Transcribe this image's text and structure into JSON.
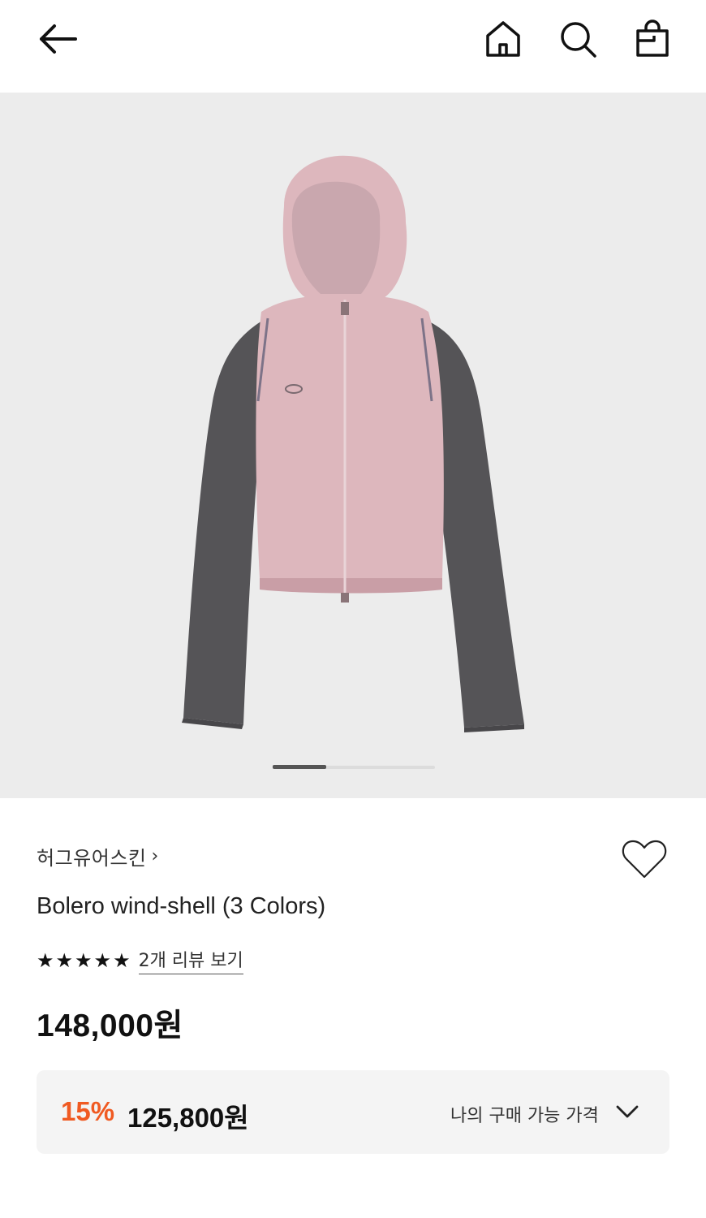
{
  "header": {
    "back_icon": "arrow-left-icon",
    "home_icon": "home-icon",
    "search_icon": "search-icon",
    "bag_icon": "shopping-bag-icon"
  },
  "gallery": {
    "image_subject": "jacket",
    "current_slide": 1,
    "slide_progress": 0.33
  },
  "product": {
    "brand": "허그유어스킨",
    "brand_chevron": "›",
    "title": "Bolero wind-shell (3 Colors)",
    "rating_stars": [
      "★",
      "★",
      "★",
      "★",
      "★"
    ],
    "rating": 5,
    "review_link": "2개 리뷰 보기",
    "price": "148,000원",
    "wishlist_icon": "heart-outline-icon"
  },
  "discount": {
    "rate": "15%",
    "price": "125,800원",
    "label": "나의 구매 가능 가격",
    "chevron_icon": "chevron-down-icon"
  },
  "colors": {
    "accent": "#f05a22",
    "jacket_pink": "#ddb7bd",
    "jacket_grey": "#555457",
    "hero_bg": "#ececec"
  }
}
